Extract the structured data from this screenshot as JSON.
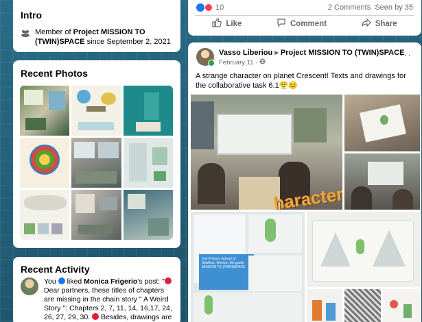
{
  "intro": {
    "title": "Intro",
    "member_prefix": "Member of",
    "project": "Project MISSION TO (TWIN)SPACE",
    "since": "since September 2, 2021"
  },
  "photos": {
    "title": "Recent Photos"
  },
  "activity": {
    "title": "Recent Activity",
    "you": "You",
    "liked": "liked",
    "person": "Monica Frigerio",
    "post_prefix": "'s post: \"",
    "text1": " Dear partners, these titles of chapters are missing in the chain story \" A Weird Story \": Chapters 2, 7, 11, 14, 16,17, 24, 26, 27, 29, 30.",
    "text2": " Besides, drawings are missing"
  },
  "prev_post": {
    "reaction_count": "10",
    "comments": "2 Comments",
    "seen": "Seen by 35",
    "like": "Like",
    "comment": "Comment",
    "share": "Share"
  },
  "post": {
    "author": "Vasso Liberiou",
    "arrow": "▸",
    "group": "Project MISSION TO (TWIN)SPACE",
    "date": "February 11 ·",
    "more": "···",
    "text": "A strange character on planet Crescent! Texts and drawings for the collaborative task 6.1😤😊",
    "overlay_word": "haracter",
    "caption": "2nd Primary School of Strathos, Greece, 5th grade MISSION TO (TWIN)SPACE"
  }
}
